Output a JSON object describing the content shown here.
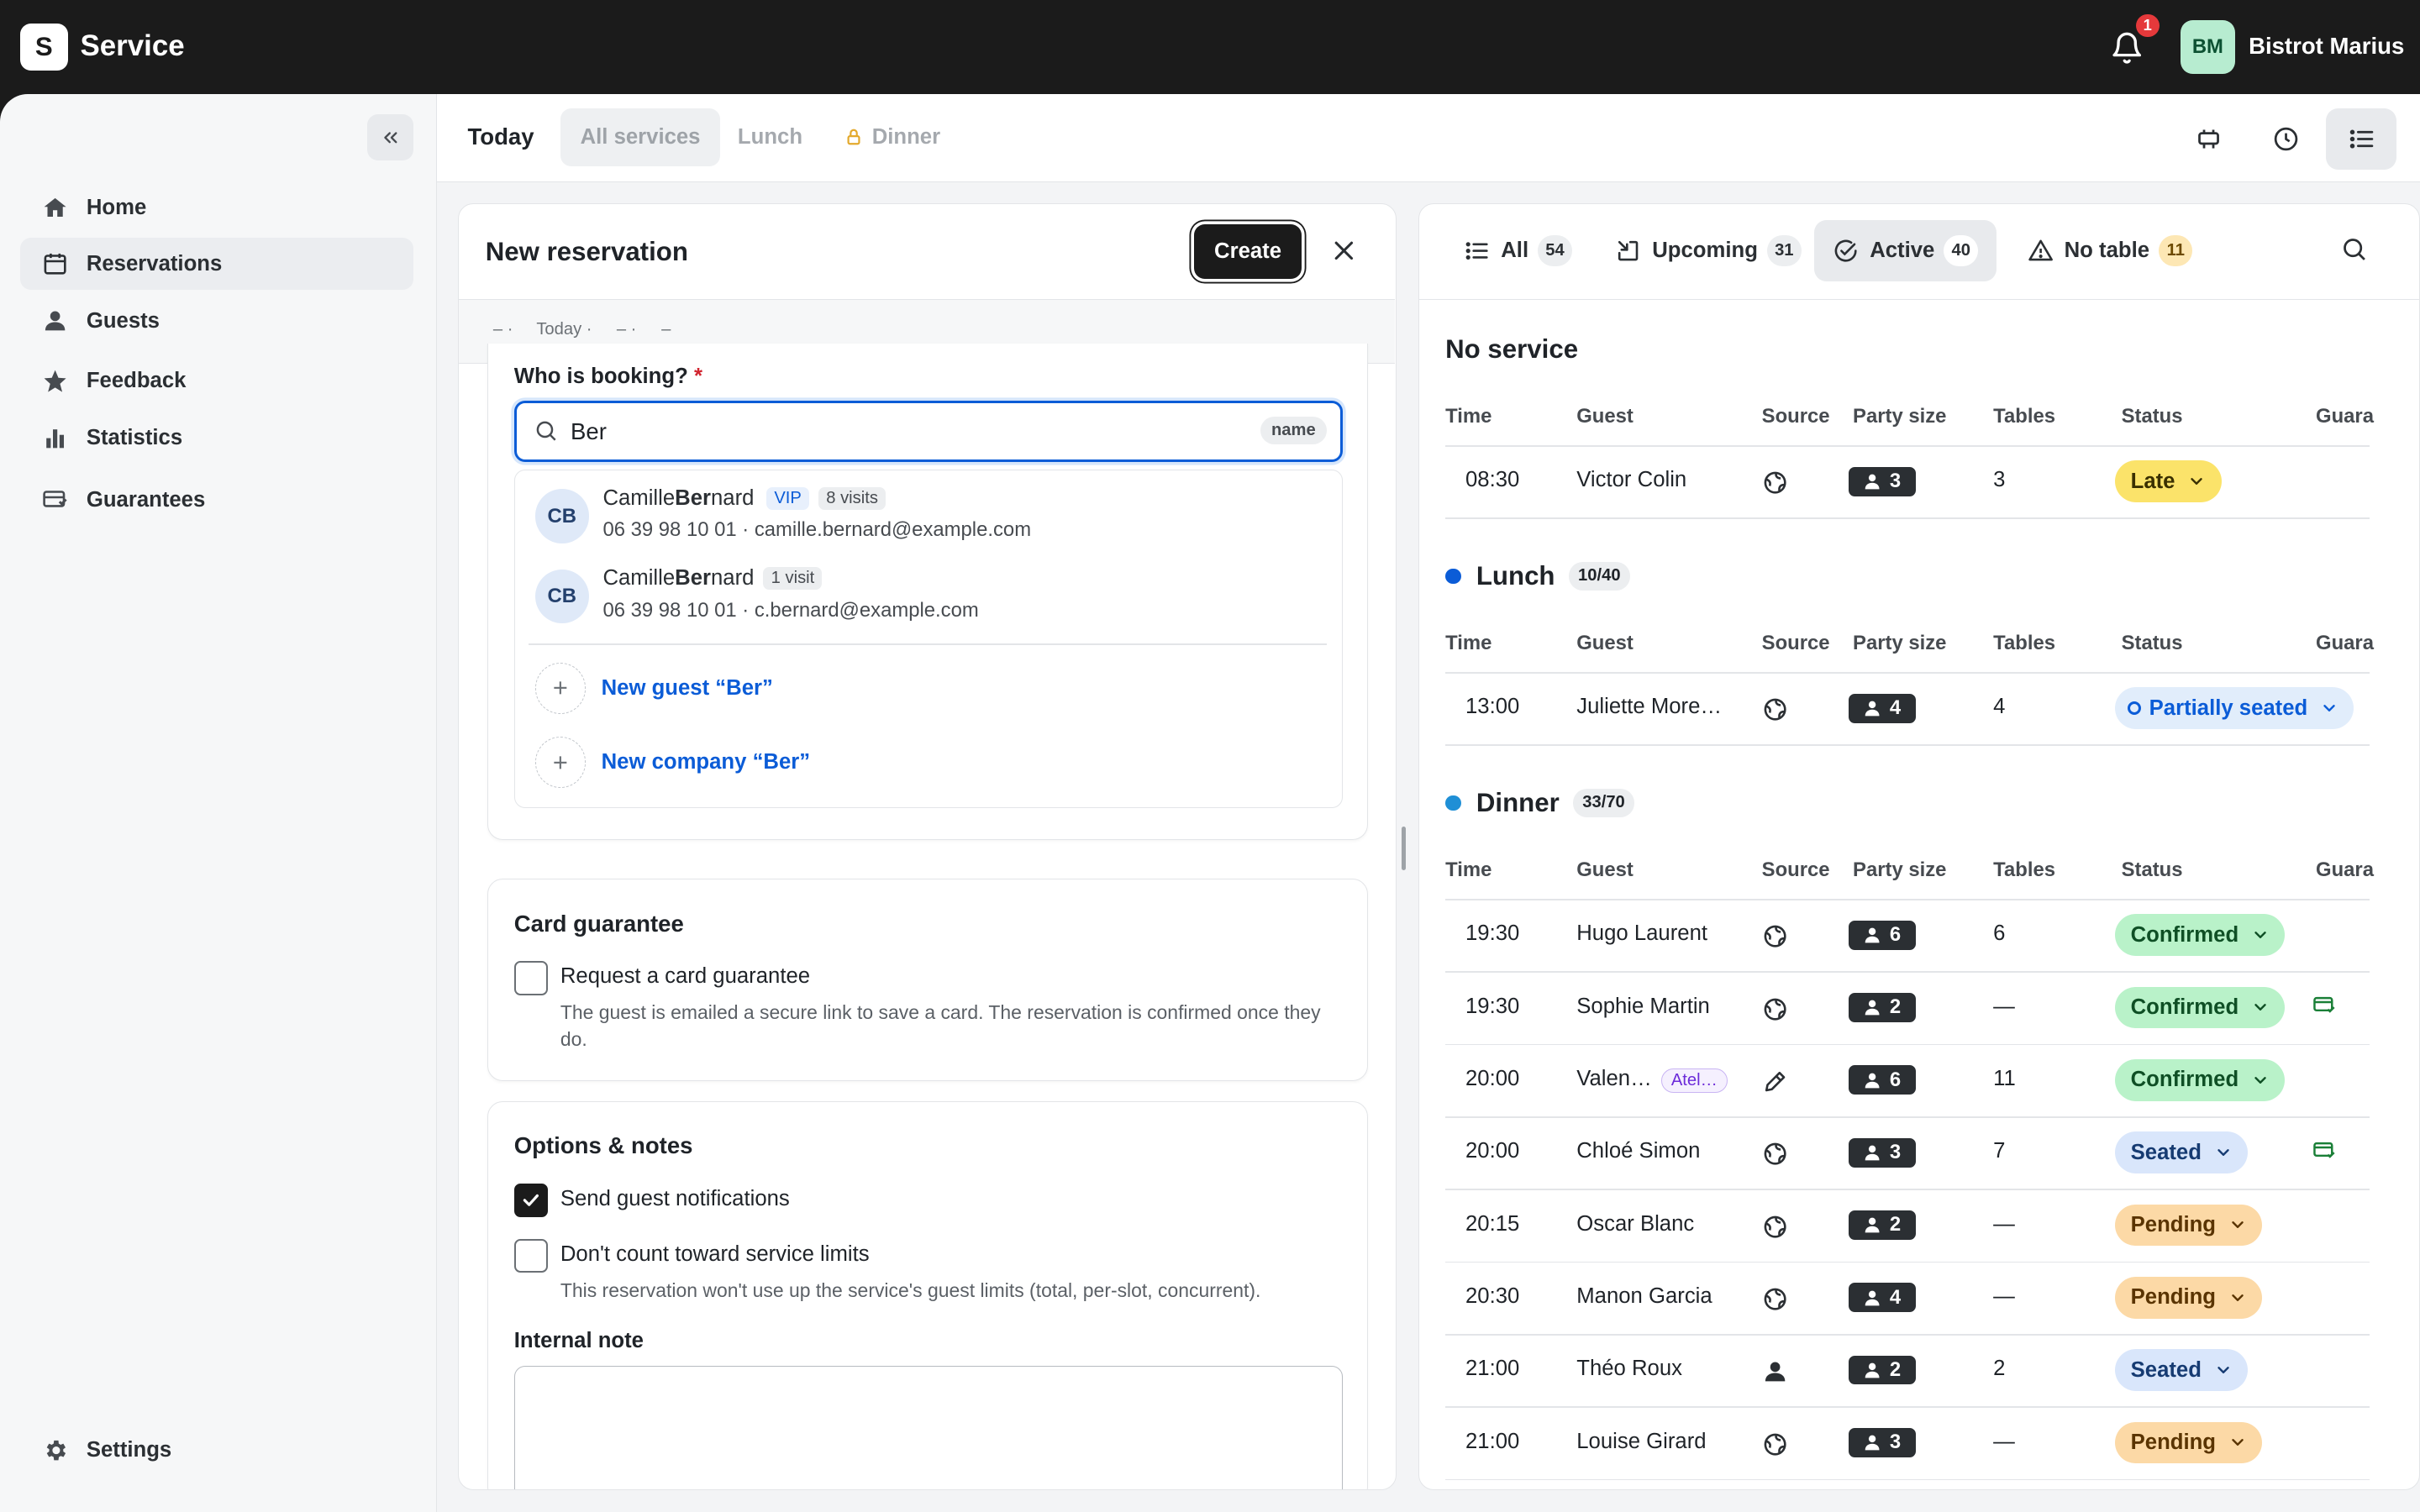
{
  "app": {
    "logo_letter": "S",
    "title": "Service",
    "notification_count": "1",
    "user_initials": "BM",
    "restaurant": "Bistrot Marius"
  },
  "sidebar": {
    "items": [
      {
        "label": "Home",
        "icon": "home-icon"
      },
      {
        "label": "Reservations",
        "icon": "calendar-icon",
        "active": true
      },
      {
        "label": "Guests",
        "icon": "person-icon"
      },
      {
        "label": "Feedback",
        "icon": "star-icon"
      },
      {
        "label": "Statistics",
        "icon": "bar-chart-icon"
      },
      {
        "label": "Guarantees",
        "icon": "card-guarantee-icon"
      }
    ],
    "settings": "Settings"
  },
  "subbar": {
    "today": "Today",
    "all_services": "All services",
    "lunch": "Lunch",
    "dinner": "Dinner"
  },
  "new_reservation": {
    "title": "New reservation",
    "create": "Create",
    "strip": [
      "– ·",
      "Today ·",
      "– ·",
      "–"
    ],
    "booking_label": "Who is booking?",
    "required_mark": "*",
    "search_value": "Ber",
    "search_chip": "name",
    "results": [
      {
        "initials": "CB",
        "name_pre": "Camille ",
        "name_match": "Ber",
        "name_post": "nard",
        "vip": "VIP",
        "visits": "8 visits",
        "sub": "06 39 98 10 01 · camille.bernard@example.com"
      },
      {
        "initials": "CB",
        "name_pre": "Camille ",
        "name_match": "Ber",
        "name_post": "nard",
        "vip": "",
        "visits": "1 visit",
        "sub": "06 39 98 10 01 · c.bernard@example.com"
      }
    ],
    "new_guest": "New guest “Ber”",
    "new_company": "New company “Ber”",
    "guarantee": {
      "title": "Card guarantee",
      "checkbox": "Request a card guarantee",
      "help": "The guest is emailed a secure link to save a card. The reservation is confirmed once they do."
    },
    "options": {
      "title": "Options & notes",
      "notify": "Send guest notifications",
      "limits": "Don't count toward service limits",
      "limits_help": "This reservation won't use up the service's guest limits (total, per-slot, concurrent).",
      "note_label": "Internal note"
    }
  },
  "list": {
    "tabs": [
      {
        "label": "All",
        "count": "54",
        "icon": "list-icon"
      },
      {
        "label": "Upcoming",
        "count": "31",
        "icon": "upcoming-icon"
      },
      {
        "label": "Active",
        "count": "40",
        "icon": "check-circle-icon",
        "active": true
      },
      {
        "label": "No table",
        "count": "11",
        "icon": "warning-icon"
      }
    ],
    "columns": [
      "Time",
      "Guest",
      "Source",
      "Party size",
      "Tables",
      "Status",
      "Guara"
    ],
    "sections": [
      {
        "title": "No service",
        "count": "",
        "dot": "",
        "rows": [
          {
            "time": "08:30",
            "guest": "Victor Colin",
            "source": "web",
            "party": "3",
            "tables": "3",
            "status": "Late",
            "kind": "late",
            "guarantee": false
          }
        ]
      },
      {
        "title": "Lunch",
        "count": "10/40",
        "dot": "#0b5cd7",
        "rows": [
          {
            "time": "13:00",
            "guest": "Juliette More…",
            "source": "web",
            "party": "4",
            "tables": "4",
            "status": "Partially seated",
            "kind": "partial",
            "guarantee": false
          }
        ]
      },
      {
        "title": "Dinner",
        "count": "33/70",
        "dot": "#1f8fd6",
        "rows": [
          {
            "time": "19:30",
            "guest": "Hugo Laurent",
            "source": "web",
            "party": "6",
            "tables": "6",
            "status": "Confirmed",
            "kind": "confirmed",
            "guarantee": false
          },
          {
            "time": "19:30",
            "guest": "Sophie Martin",
            "source": "web",
            "party": "2",
            "tables": "—",
            "status": "Confirmed",
            "kind": "confirmed",
            "guarantee": true
          },
          {
            "time": "20:00",
            "guest": "Valen…",
            "tag": "Atel…",
            "source": "manual",
            "party": "6",
            "tables": "11",
            "status": "Confirmed",
            "kind": "confirmed",
            "guarantee": false
          },
          {
            "time": "20:00",
            "guest": "Chloé Simon",
            "source": "web",
            "party": "3",
            "tables": "7",
            "status": "Seated",
            "kind": "seated",
            "guarantee": true
          },
          {
            "time": "20:15",
            "guest": "Oscar Blanc",
            "source": "web",
            "party": "2",
            "tables": "—",
            "status": "Pending",
            "kind": "pending",
            "guarantee": false
          },
          {
            "time": "20:30",
            "guest": "Manon Garcia",
            "source": "web",
            "party": "4",
            "tables": "—",
            "status": "Pending",
            "kind": "pending",
            "guarantee": false
          },
          {
            "time": "21:00",
            "guest": "Théo Roux",
            "source": "walk-in",
            "party": "2",
            "tables": "2",
            "status": "Seated",
            "kind": "seated",
            "guarantee": false
          },
          {
            "time": "21:00",
            "guest": "Louise Girard",
            "source": "web",
            "party": "3",
            "tables": "—",
            "status": "Pending",
            "kind": "pending",
            "guarantee": false
          }
        ]
      }
    ]
  }
}
